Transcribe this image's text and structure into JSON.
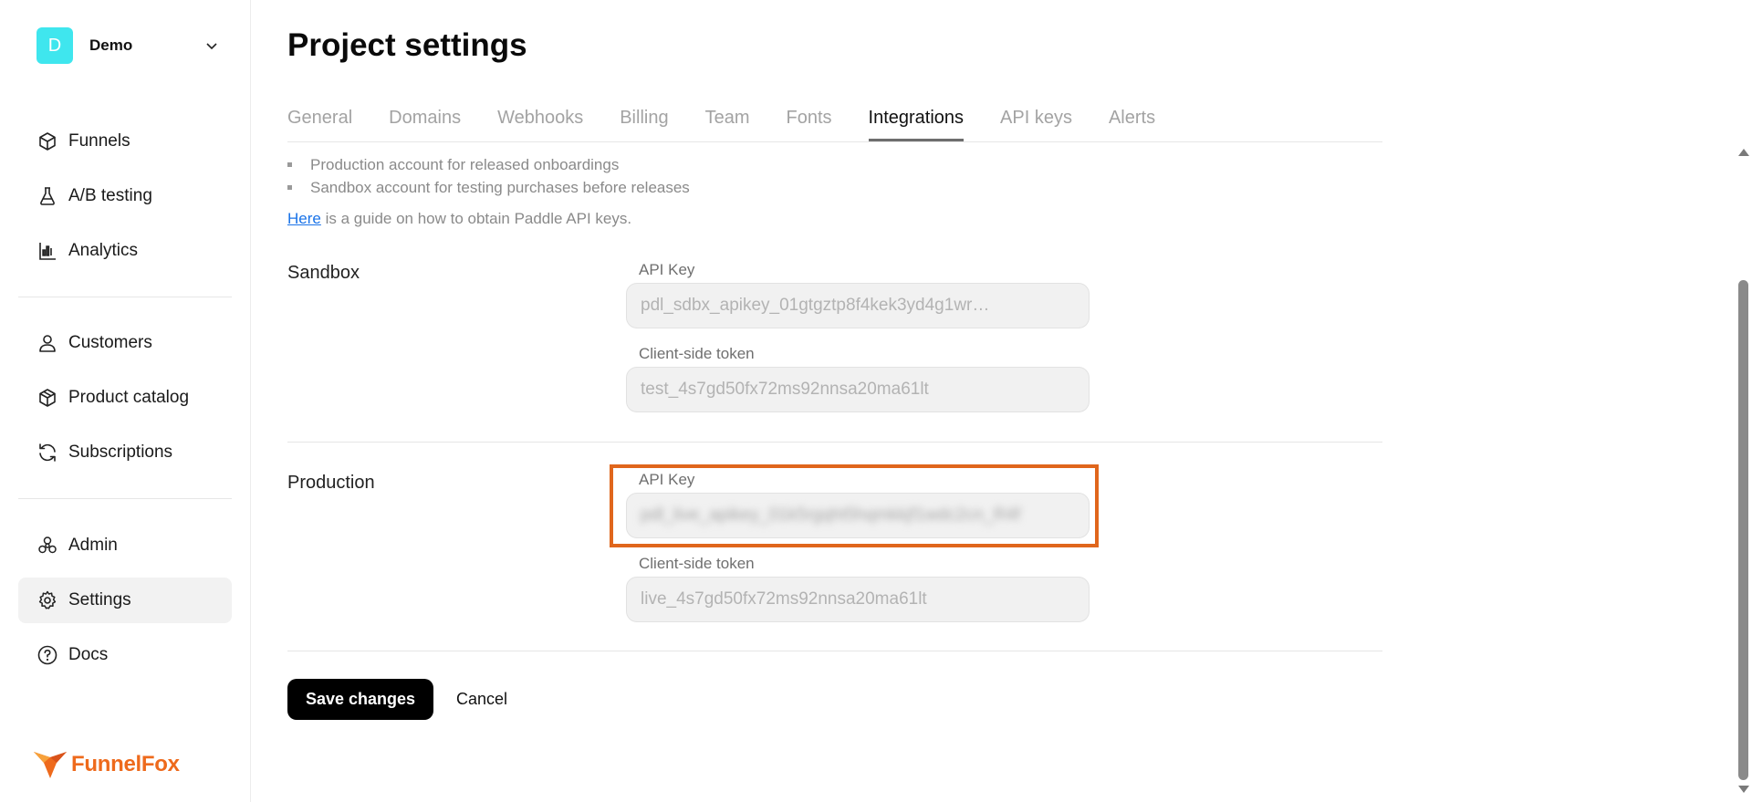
{
  "workspace": {
    "initial": "D",
    "name": "Demo"
  },
  "nav": {
    "primary": [
      {
        "label": "Funnels",
        "icon": "cube-icon"
      },
      {
        "label": "A/B testing",
        "icon": "flask-icon"
      },
      {
        "label": "Analytics",
        "icon": "bar-chart-icon"
      }
    ],
    "secondary": [
      {
        "label": "Customers",
        "icon": "user-icon"
      },
      {
        "label": "Product catalog",
        "icon": "package-icon"
      },
      {
        "label": "Subscriptions",
        "icon": "refresh-icon"
      }
    ],
    "tertiary": [
      {
        "label": "Admin",
        "icon": "biohazard-icon"
      },
      {
        "label": "Settings",
        "icon": "gear-icon",
        "active": true
      },
      {
        "label": "Docs",
        "icon": "help-circle-icon"
      }
    ]
  },
  "logo": {
    "text": "FunnelFox",
    "color": "#ee6a1c"
  },
  "page": {
    "title": "Project settings"
  },
  "tabs": [
    {
      "label": "General"
    },
    {
      "label": "Domains"
    },
    {
      "label": "Webhooks"
    },
    {
      "label": "Billing"
    },
    {
      "label": "Team"
    },
    {
      "label": "Fonts"
    },
    {
      "label": "Integrations",
      "active": true
    },
    {
      "label": "API keys"
    },
    {
      "label": "Alerts"
    }
  ],
  "intro": {
    "bullets": [
      "Production account for released onboardings",
      "Sandbox account for testing purchases before releases"
    ],
    "guide_link": "Here",
    "guide_text": " is a guide on how to obtain Paddle API keys."
  },
  "sandbox": {
    "title": "Sandbox",
    "api_key_label": "API Key",
    "api_key_value": "pdl_sdbx_apikey_01gtgztp8f4kek3yd4g1wr…",
    "client_token_label": "Client-side token",
    "client_token_value": "test_4s7gd50fx72ms92nnsa20ma61lt"
  },
  "production": {
    "title": "Production",
    "api_key_label": "API Key",
    "api_key_value": "pdl_live_apikey_01k5rgqht5hqmkkjf1wdc2cn_R4f",
    "client_token_label": "Client-side token",
    "client_token_value": "live_4s7gd50fx72ms92nnsa20ma61lt"
  },
  "actions": {
    "save": "Save changes",
    "cancel": "Cancel"
  },
  "colors": {
    "accent": "#e0661c",
    "avatar": "#3fe6ee"
  }
}
